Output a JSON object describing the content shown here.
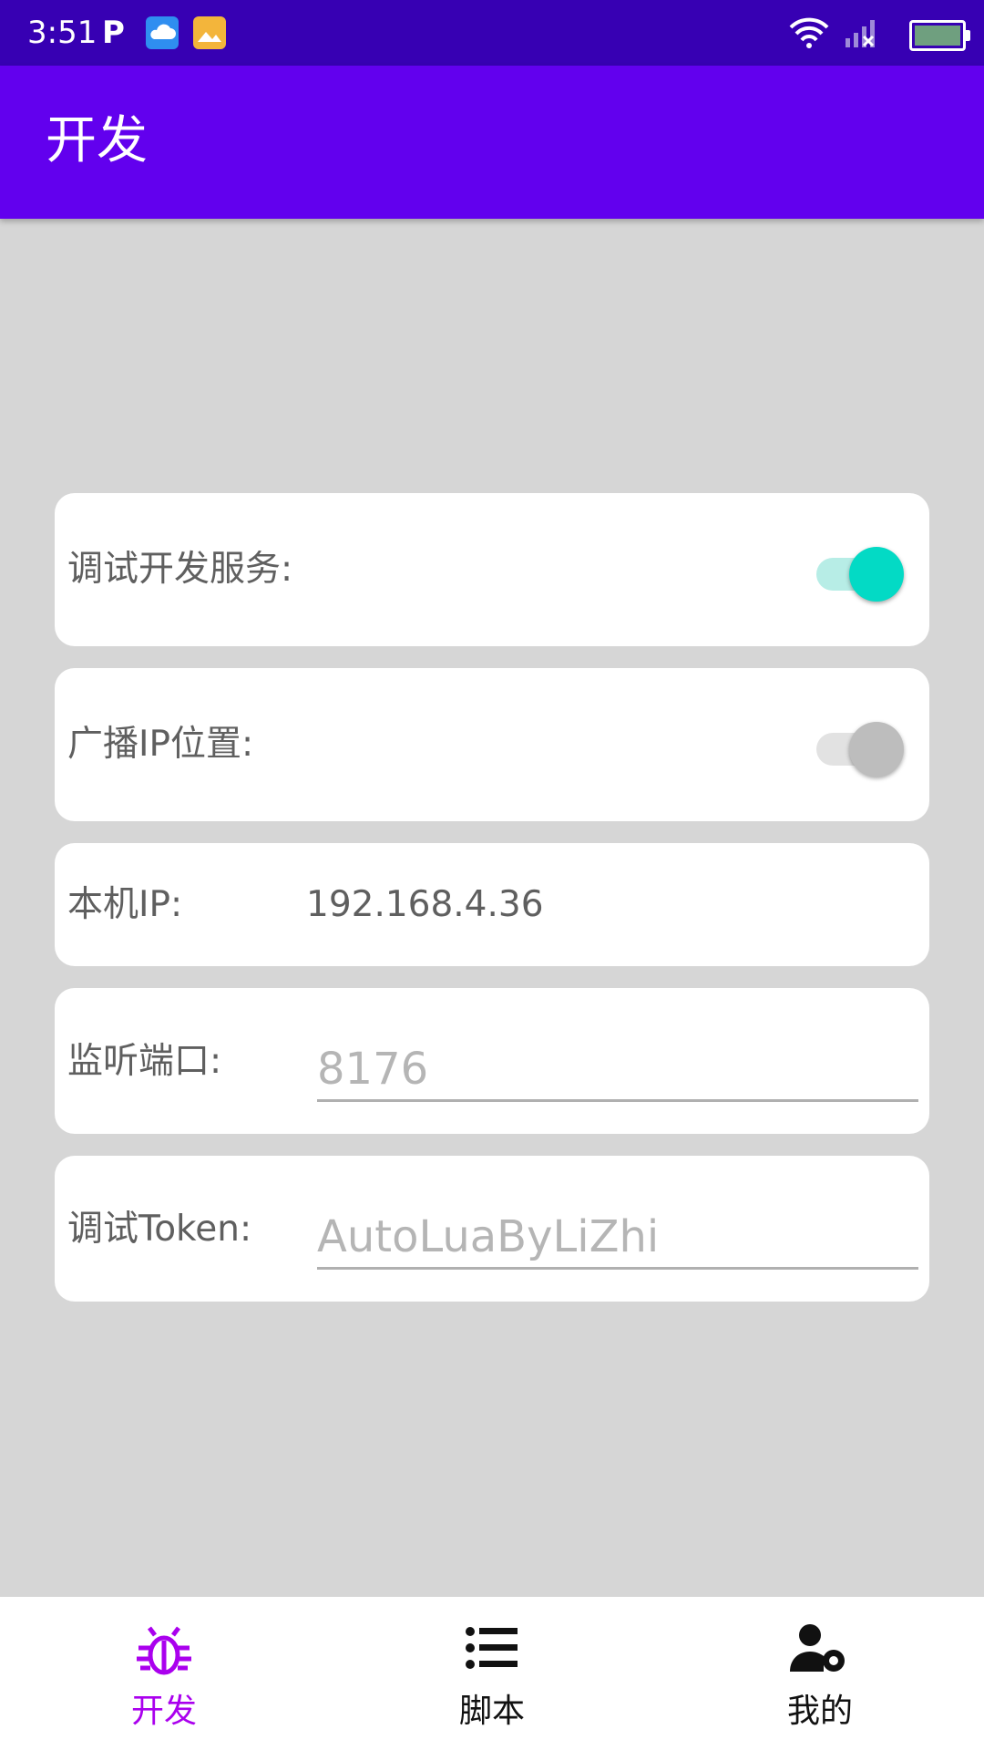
{
  "status_bar": {
    "time": "3:51",
    "p_icon": "P",
    "icons": [
      "p-notification-icon",
      "cloud-app-icon",
      "gallery-app-icon",
      "wifi-icon",
      "signal-icon",
      "battery-icon"
    ]
  },
  "app_bar": {
    "title": "开发"
  },
  "settings": {
    "debug_service": {
      "label": "调试开发服务:",
      "enabled": true
    },
    "broadcast_ip": {
      "label": "广播IP位置:",
      "enabled": false
    },
    "local_ip": {
      "label": "本机IP:",
      "value": "192.168.4.36"
    },
    "listen_port": {
      "label": "监听端口:",
      "placeholder": "8176"
    },
    "debug_token": {
      "label": "调试Token:",
      "placeholder": "AutoLuaByLiZhi"
    }
  },
  "bottom_nav": {
    "items": [
      {
        "label": "开发",
        "icon": "bug-icon",
        "active": true
      },
      {
        "label": "脚本",
        "icon": "list-icon",
        "active": false
      },
      {
        "label": "我的",
        "icon": "user-settings-icon",
        "active": false
      }
    ]
  },
  "colors": {
    "status_bar": "#3700b3",
    "app_bar": "#6200ee",
    "accent_active_nav": "#aa00ee",
    "toggle_on": "#03dac5"
  }
}
